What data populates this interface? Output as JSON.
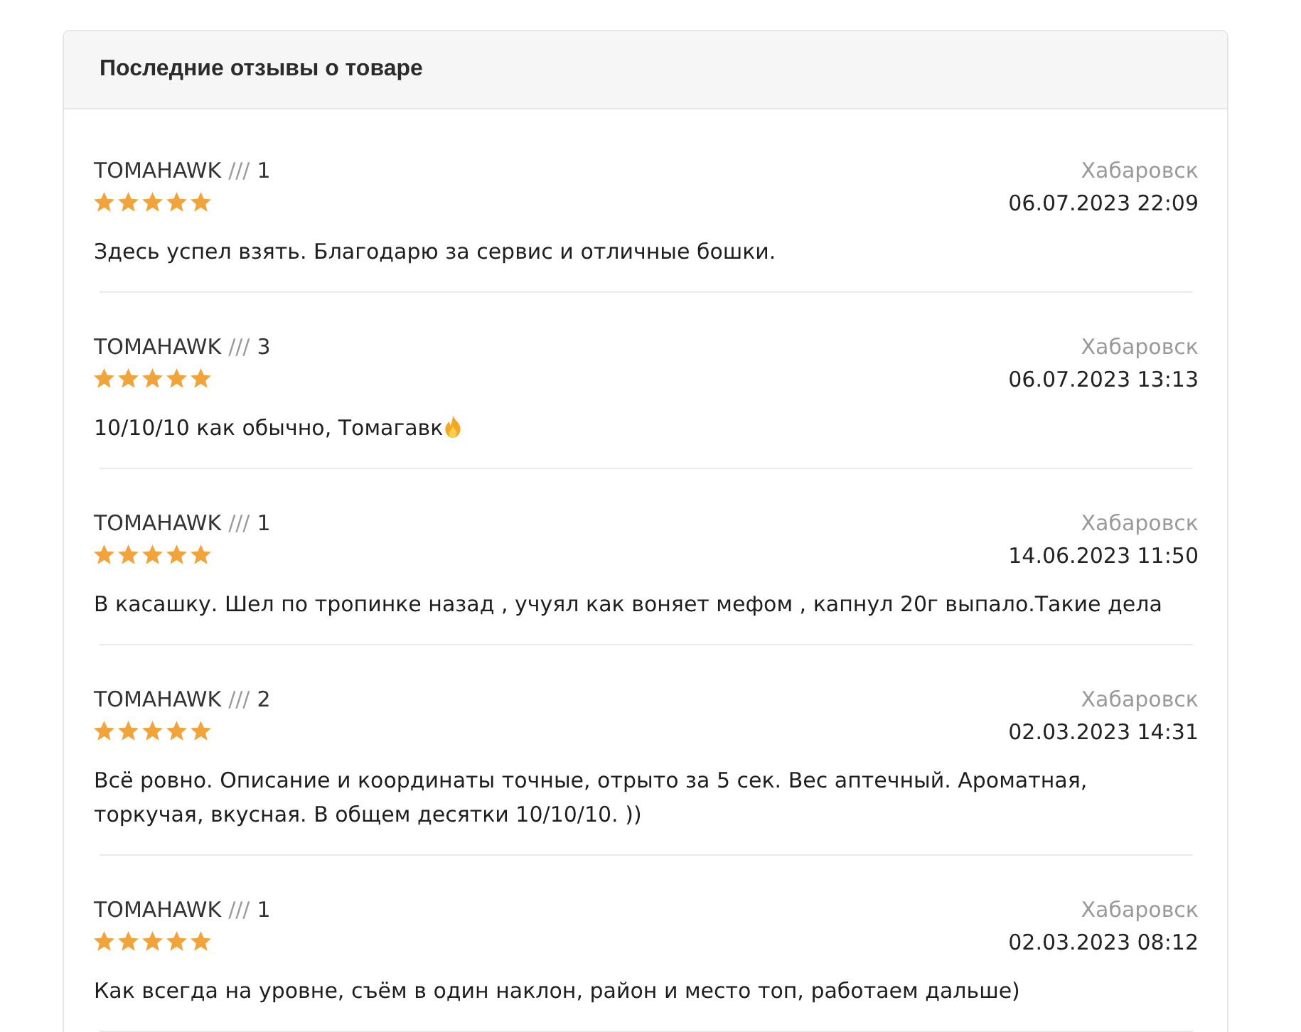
{
  "panel": {
    "title": "Последние отзывы о товаре"
  },
  "reviews": [
    {
      "author": "TOMAHAWK",
      "separator": "///",
      "count": "1",
      "stars": 5,
      "city": "Хабаровск",
      "date": "06.07.2023 22:09",
      "text": "Здесь успел взять. Благодарю за сервис и отличные бошки.",
      "trailing_icon": false
    },
    {
      "author": "TOMAHAWK",
      "separator": "///",
      "count": "3",
      "stars": 5,
      "city": "Хабаровск",
      "date": "06.07.2023 13:13",
      "text": "10/10/10 как обычно, Томагавк",
      "trailing_icon": true
    },
    {
      "author": "TOMAHAWK",
      "separator": "///",
      "count": "1",
      "stars": 5,
      "city": "Хабаровск",
      "date": "14.06.2023 11:50",
      "text": "В касашку. Шел по тропинке назад , учуял как воняет мефом , капнул 20г выпало.Такие дела",
      "trailing_icon": false
    },
    {
      "author": "TOMAHAWK",
      "separator": "///",
      "count": "2",
      "stars": 5,
      "city": "Хабаровск",
      "date": "02.03.2023 14:31",
      "text": "Всё ровно. Описание и координаты точные, отрыто за 5 сек. Вес аптечный. Ароматная, торкучая, вкусная. В общем десятки 10/10/10. ))",
      "trailing_icon": false
    },
    {
      "author": "TOMAHAWK",
      "separator": "///",
      "count": "1",
      "stars": 5,
      "city": "Хабаровск",
      "date": "02.03.2023 08:12",
      "text": "Как всегда на уровне, съём в один наклон, район и место топ, работаем дальше)",
      "trailing_icon": false
    }
  ]
}
